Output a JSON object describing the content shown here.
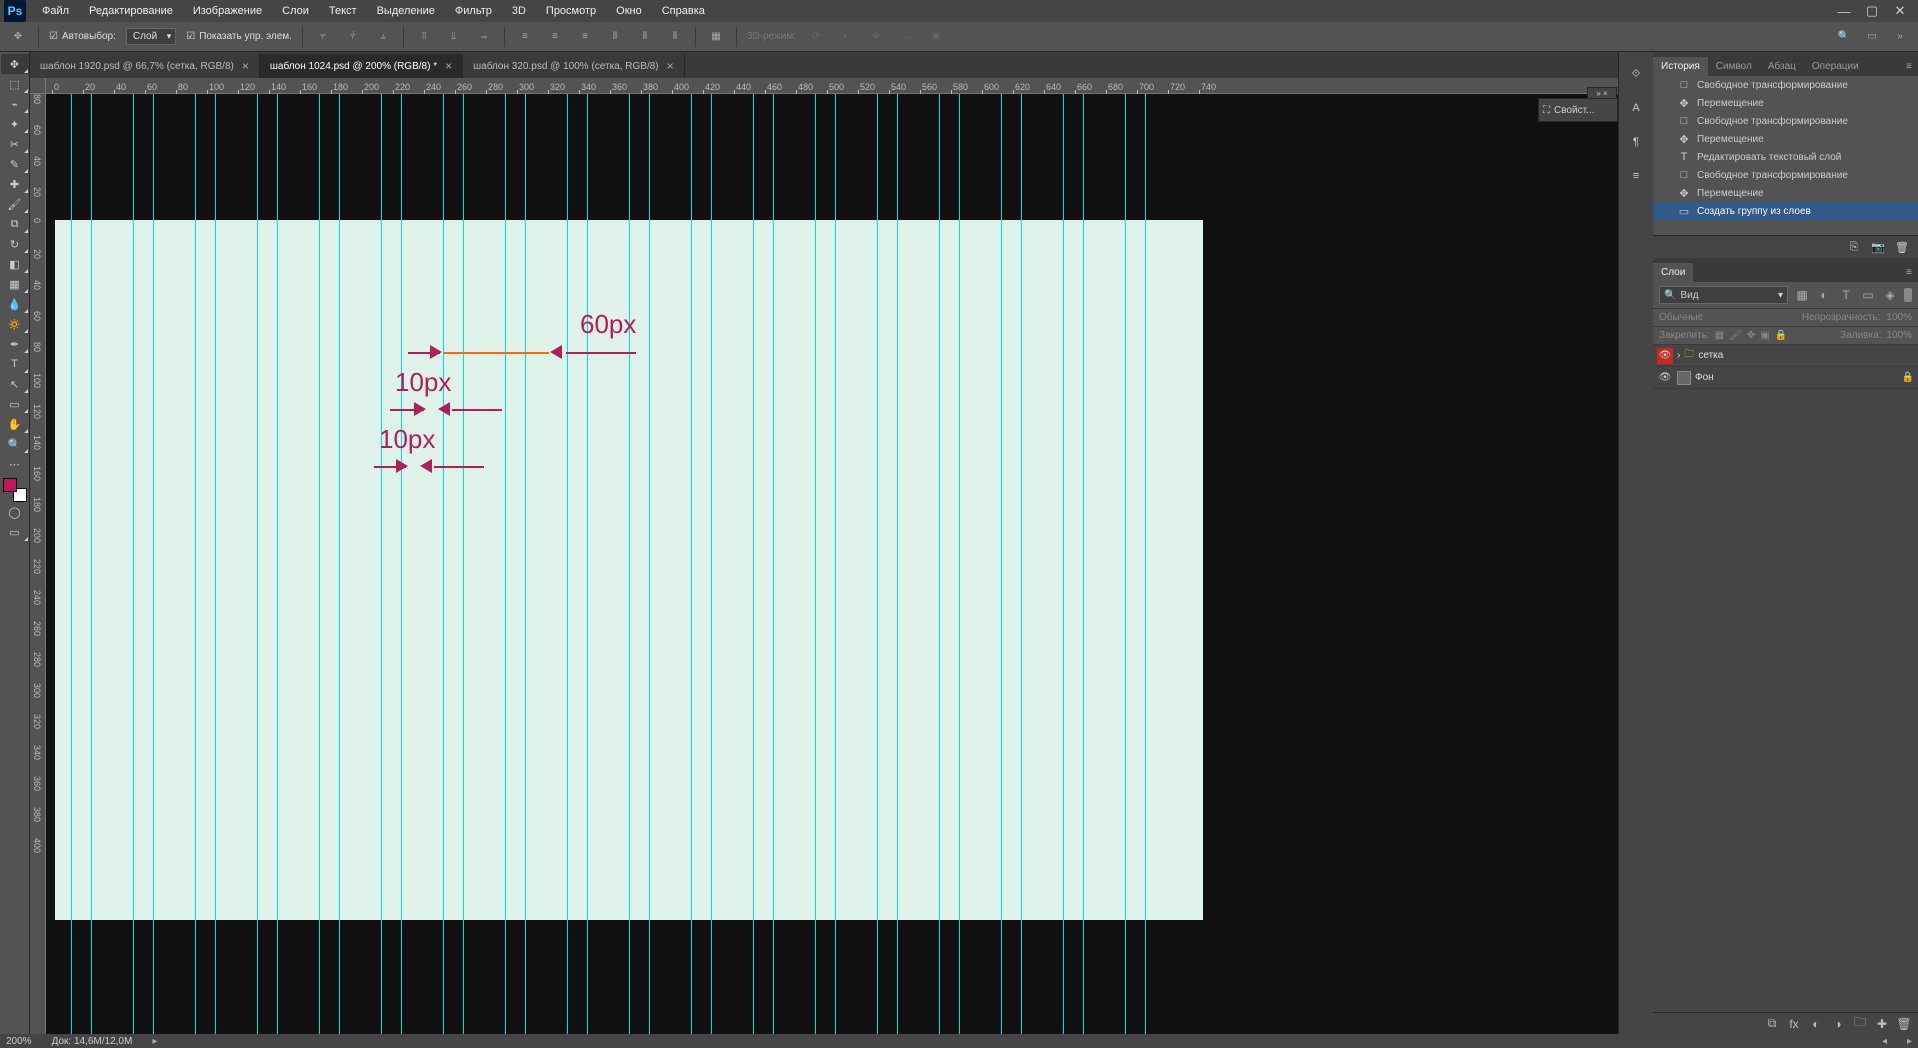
{
  "menu": [
    "Файл",
    "Редактирование",
    "Изображение",
    "Слои",
    "Текст",
    "Выделение",
    "Фильтр",
    "3D",
    "Просмотр",
    "Окно",
    "Справка"
  ],
  "optbar": {
    "autoselect": "Автовыбор:",
    "autoselect_val": "Слой",
    "show_controls": "Показать упр. элем.",
    "mode3d": "3D-режим:"
  },
  "tabs": [
    {
      "title": "шаблон 1920.psd @ 66,7% (сетка, RGB/8)",
      "active": false
    },
    {
      "title": "шаблон 1024.psd @ 200% (RGB/8) *",
      "active": true
    },
    {
      "title": "шаблон 320.psd @ 100% (сетка, RGB/8)",
      "active": false
    }
  ],
  "ruler_ticks": [
    "0",
    "20",
    "40",
    "60",
    "80",
    "100",
    "120",
    "140",
    "160",
    "180",
    "200",
    "220",
    "240",
    "260",
    "280",
    "300",
    "320",
    "340",
    "360",
    "380",
    "400",
    "420",
    "440",
    "460",
    "480",
    "500",
    "520",
    "540",
    "560",
    "580",
    "600",
    "620",
    "640",
    "660",
    "680",
    "700",
    "720",
    "740"
  ],
  "ruler_vticks": [
    "80",
    "60",
    "40",
    "20",
    "0",
    "20",
    "40",
    "60",
    "80",
    "100",
    "120",
    "140",
    "160",
    "180",
    "200",
    "220",
    "240",
    "260",
    "280",
    "300",
    "320",
    "340",
    "360",
    "380",
    "400"
  ],
  "canvas": {
    "labels": {
      "l60": "60px",
      "l10a": "10px",
      "l10b": "10px"
    }
  },
  "floating_panel": "Свойст...",
  "history_tabs": [
    "История",
    "Символ",
    "Абзац",
    "Операции"
  ],
  "history": [
    {
      "icon": "□",
      "label": "Свободное трансформирование"
    },
    {
      "icon": "✥",
      "label": "Перемещение"
    },
    {
      "icon": "□",
      "label": "Свободное трансформирование"
    },
    {
      "icon": "✥",
      "label": "Перемещение"
    },
    {
      "icon": "T",
      "label": "Редактировать текстовый слой"
    },
    {
      "icon": "□",
      "label": "Свободное трансформирование"
    },
    {
      "icon": "✥",
      "label": "Перемещение"
    },
    {
      "icon": "▭",
      "label": "Создать группу из слоев",
      "active": true
    }
  ],
  "layers_tab": "Слои",
  "layers_search": "Вид",
  "blend_mode": "Обычные",
  "opacity_label": "Непрозрачность:",
  "opacity_val": "100%",
  "lock_label": "Закрепить:",
  "fill_label": "Заливка:",
  "fill_val": "100%",
  "layers": [
    {
      "name": "сетка",
      "folder": true,
      "sel": true
    },
    {
      "name": "Фон",
      "folder": false,
      "lock": true
    }
  ],
  "status": {
    "zoom": "200%",
    "doc": "Док: 14,6M/12,0M"
  }
}
